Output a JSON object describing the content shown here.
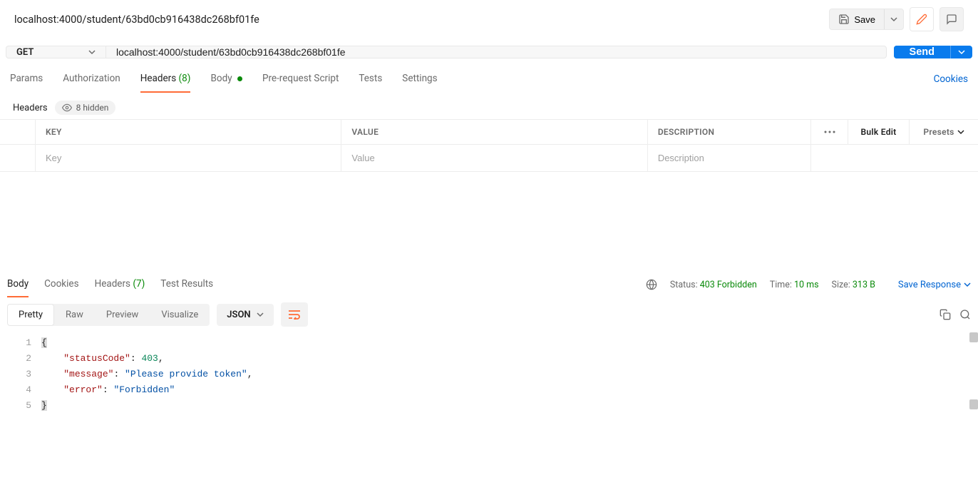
{
  "title": "localhost:4000/student/63bd0cb916438dc268bf01fe",
  "save": {
    "label": "Save"
  },
  "request": {
    "method": "GET",
    "url": "localhost:4000/student/63bd0cb916438dc268bf01fe",
    "send": "Send"
  },
  "tabs": {
    "params": "Params",
    "authorization": "Authorization",
    "headers": "Headers",
    "headers_count": "(8)",
    "body": "Body",
    "prerequest": "Pre-request Script",
    "tests": "Tests",
    "settings": "Settings",
    "cookies": "Cookies"
  },
  "headers_section": {
    "label": "Headers",
    "hidden": "8 hidden",
    "columns": {
      "key": "KEY",
      "value": "VALUE",
      "description": "DESCRIPTION",
      "bulk": "Bulk Edit",
      "presets": "Presets"
    },
    "placeholders": {
      "key": "Key",
      "value": "Value",
      "description": "Description"
    }
  },
  "response": {
    "tabs": {
      "body": "Body",
      "cookies": "Cookies",
      "headers": "Headers",
      "headers_count": "(7)",
      "test_results": "Test Results"
    },
    "status_label": "Status:",
    "status_value": "403 Forbidden",
    "time_label": "Time:",
    "time_value": "10 ms",
    "size_label": "Size:",
    "size_value": "313 B",
    "save_response": "Save Response",
    "view_tabs": {
      "pretty": "Pretty",
      "raw": "Raw",
      "preview": "Preview",
      "visualize": "Visualize"
    },
    "json_label": "JSON",
    "body_lines": [
      {
        "n": 1,
        "raw": "{"
      },
      {
        "n": 2,
        "indent": "    ",
        "key": "\"statusCode\"",
        "sep": ": ",
        "val": "403",
        "suffix": ",",
        "vtype": "num"
      },
      {
        "n": 3,
        "indent": "    ",
        "key": "\"message\"",
        "sep": ": ",
        "val": "\"Please provide token\"",
        "suffix": ",",
        "vtype": "str"
      },
      {
        "n": 4,
        "indent": "    ",
        "key": "\"error\"",
        "sep": ": ",
        "val": "\"Forbidden\"",
        "suffix": "",
        "vtype": "str"
      },
      {
        "n": 5,
        "raw": "}"
      }
    ]
  }
}
